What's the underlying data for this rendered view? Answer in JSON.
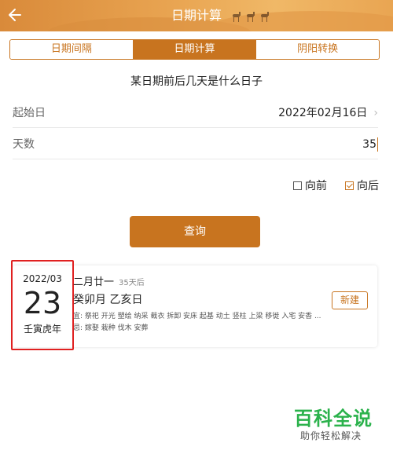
{
  "header": {
    "title": "日期计算"
  },
  "tabs": [
    {
      "label": "日期间隔"
    },
    {
      "label": "日期计算"
    },
    {
      "label": "阴阳转换"
    }
  ],
  "form": {
    "subtitle": "某日期前后几天是什么日子",
    "start_label": "起始日",
    "start_value": "2022年02月16日",
    "days_label": "天数",
    "days_value": "35",
    "forward_label": "向前",
    "forward_checked": false,
    "backward_label": "向后",
    "backward_checked": true,
    "query_label": "查询"
  },
  "result": {
    "year_month": "2022/03",
    "day": "23",
    "ganzhi_year": "壬寅虎年",
    "lunar_date": "二月廿一",
    "after_text": "35天后",
    "ganzhi_month_day": "癸卯月  乙亥日",
    "yi_text": "宜: 祭祀 开光 塑绘 纳采 裁衣 拆卸 安床 起基 动土 竖柱 上梁 移徙 入宅 安香 ...",
    "ji_text": "忌: 嫁娶 栽种 伐木 安葬",
    "new_label": "新建"
  },
  "watermark": {
    "title": "百科全说",
    "subtitle": "助你轻松解决"
  },
  "colors": {
    "accent": "#c8741f",
    "highlight": "#e02020",
    "watermark": "#2bb24c"
  }
}
